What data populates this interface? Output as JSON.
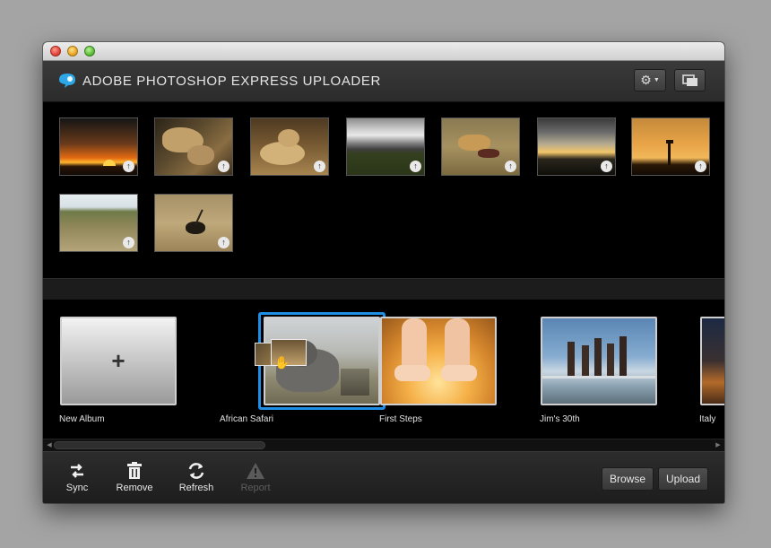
{
  "app": {
    "title": "ADOBE PHOTOSHOP EXPRESS UPLOADER"
  },
  "header": {
    "gear_icon": "gear-icon",
    "window_icon": "window-stack-icon"
  },
  "photos": [
    {
      "subject": "sunset-over-plain"
    },
    {
      "subject": "lioness-drinking"
    },
    {
      "subject": "lions-resting"
    },
    {
      "subject": "cloudy-savanna"
    },
    {
      "subject": "cheetah-with-kill"
    },
    {
      "subject": "sunset-clouds"
    },
    {
      "subject": "giraffe-silhouette"
    },
    {
      "subject": "grassland"
    },
    {
      "subject": "sable-antelope"
    }
  ],
  "albums": [
    {
      "label": "New Album"
    },
    {
      "label": "African Safari"
    },
    {
      "label": "First Steps"
    },
    {
      "label": "Jim's 30th"
    },
    {
      "label": "Italy"
    }
  ],
  "toolbar": {
    "sync": "Sync",
    "remove": "Remove",
    "refresh": "Refresh",
    "report": "Report"
  },
  "buttons": {
    "browse": "Browse",
    "upload": "Upload"
  },
  "colors": {
    "selection": "#1f8fe6",
    "header": "#333333",
    "background": "#000000"
  }
}
